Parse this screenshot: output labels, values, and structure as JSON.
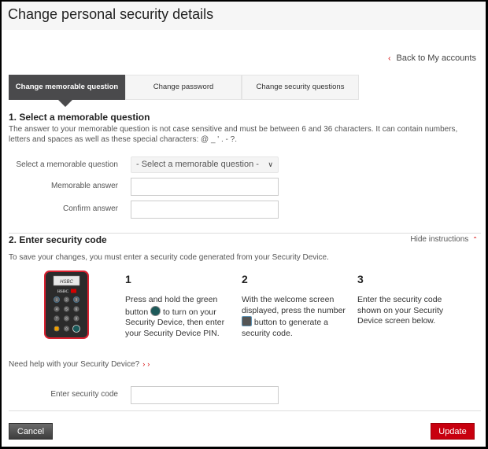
{
  "header": {
    "title": "Change personal security details"
  },
  "back_link": {
    "label": "Back to My accounts",
    "icon": "chevron-left-icon"
  },
  "tabs": [
    {
      "label": "Change memorable question",
      "active": true
    },
    {
      "label": "Change password",
      "active": false
    },
    {
      "label": "Change security questions",
      "active": false
    }
  ],
  "section1": {
    "title": "1. Select a memorable question",
    "description": "The answer to your memorable question is not case sensitive and must be between 6 and 36 characters. It can contain numbers, letters and spaces as well as these special characters: @ _ ' . - ?.",
    "fields": {
      "question_label": "Select a memorable question",
      "question_selected": "- Select a memorable question -",
      "answer_label": "Memorable answer",
      "answer_value": "",
      "confirm_label": "Confirm answer",
      "confirm_value": ""
    }
  },
  "section2": {
    "title": "2. Enter security code",
    "hide_instructions": "Hide instructions",
    "description": "To save your changes, you must enter a security code generated from your Security Device.",
    "device": {
      "screen_text": "HSBC",
      "brand": "HSBC",
      "keys": [
        "1",
        "2",
        "3",
        "4",
        "5",
        "6",
        "7",
        "8",
        "9",
        "",
        "0",
        ""
      ]
    },
    "steps": [
      {
        "number": "1",
        "text_before": "Press and hold the green button",
        "text_after": "to turn on your Security Device, then enter your Security Device PIN."
      },
      {
        "number": "2",
        "text_before": "With the welcome screen displayed, press the number",
        "text_after": "button to generate a security code."
      },
      {
        "number": "3",
        "text": "Enter the security code shown on your Security Device screen below."
      }
    ],
    "help_link": "Need help with your Security Device?",
    "code_label": "Enter security code",
    "code_value": ""
  },
  "actions": {
    "cancel": "Cancel",
    "update": "Update"
  },
  "colors": {
    "accent": "#c8000f",
    "tab_active": "#4a4a4c"
  }
}
